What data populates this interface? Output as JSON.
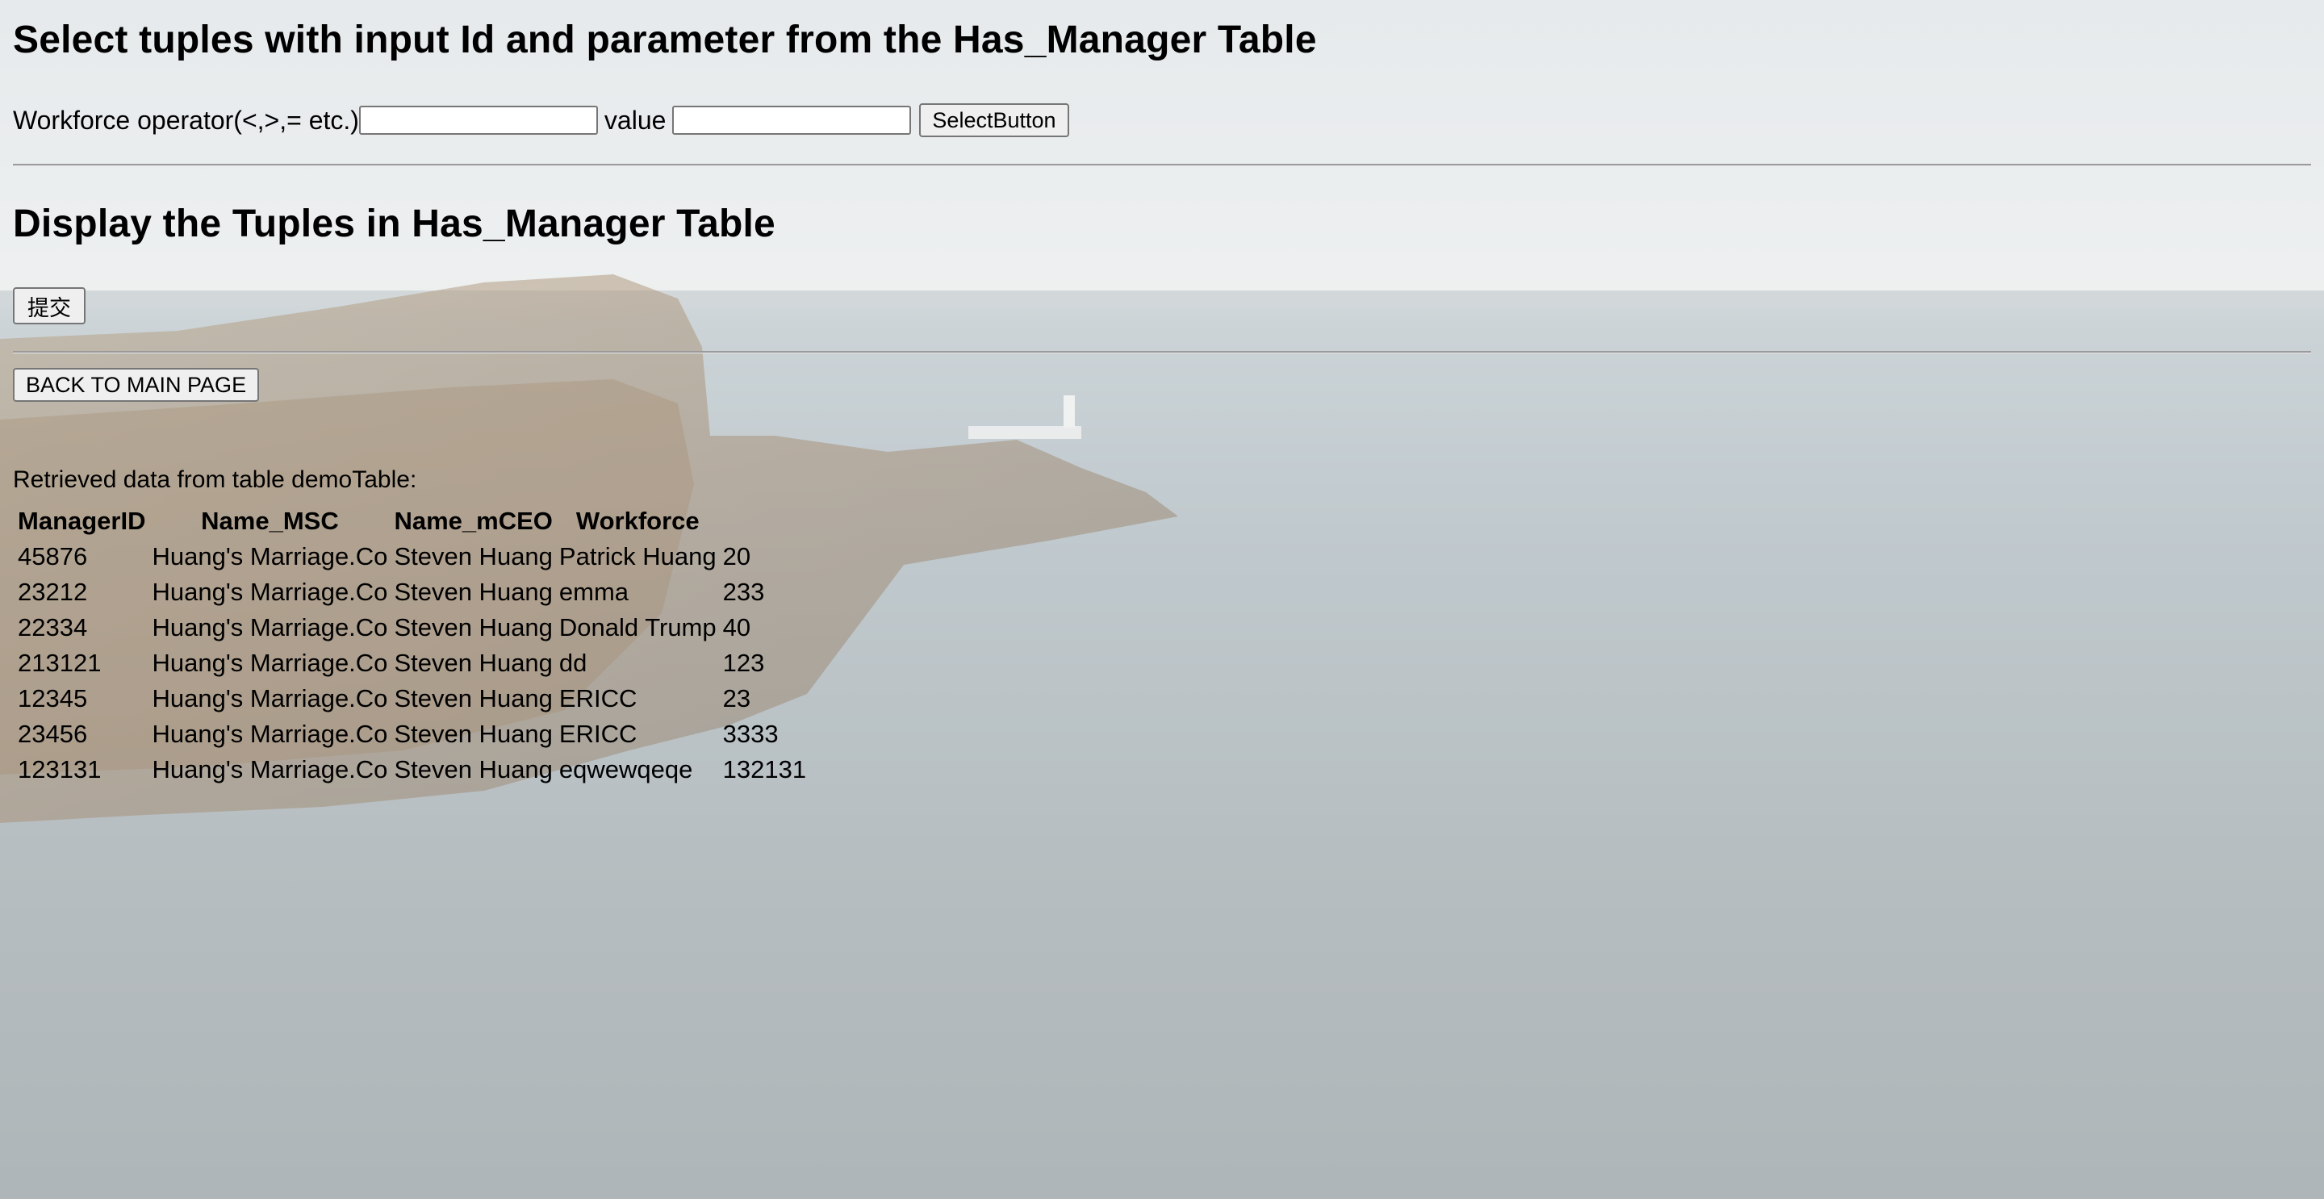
{
  "select_section": {
    "heading": "Select tuples with input Id and parameter from the Has_Manager Table",
    "operator_label": "Workforce operator(<,>,= etc.)",
    "operator_value": "",
    "value_label": "value",
    "value_value": "",
    "select_button": "SelectButton"
  },
  "display_section": {
    "heading": "Display the Tuples in Has_Manager Table",
    "submit_button": "提交"
  },
  "back_button": "BACK TO MAIN PAGE",
  "retrieved_text": "Retrieved data from table demoTable:",
  "table": {
    "headers": [
      "ManagerID",
      "Name_MSC",
      "Name_mCEO",
      "Workforce"
    ],
    "rows": [
      [
        "45876",
        "Huang's Marriage.Co",
        "Steven Huang",
        "Patrick Huang",
        "20"
      ],
      [
        "23212",
        "Huang's Marriage.Co",
        "Steven Huang",
        "emma",
        "233"
      ],
      [
        "22334",
        "Huang's Marriage.Co",
        "Steven Huang",
        "Donald Trump",
        "40"
      ],
      [
        "213121",
        "Huang's Marriage.Co",
        "Steven Huang",
        "dd",
        "123"
      ],
      [
        "12345",
        "Huang's Marriage.Co",
        "Steven Huang",
        "ERICC",
        "23"
      ],
      [
        "23456",
        "Huang's Marriage.Co",
        "Steven Huang",
        "ERICC",
        "3333"
      ],
      [
        "123131",
        "Huang's Marriage.Co",
        "Steven Huang",
        "eqwewqeqe",
        "132131"
      ]
    ]
  }
}
